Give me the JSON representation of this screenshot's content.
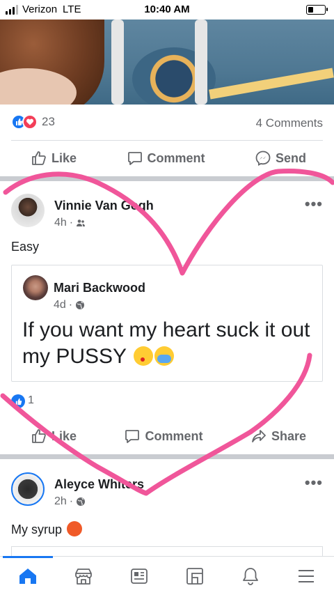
{
  "status_bar": {
    "carrier": "Verizon",
    "network": "LTE",
    "time": "10:40 AM"
  },
  "top_post": {
    "reaction_count": "23",
    "comments": "4 Comments"
  },
  "actions_top": {
    "like": "Like",
    "comment": "Comment",
    "send": "Send"
  },
  "post2": {
    "author": "Vinnie Van Gogh",
    "time": "4h",
    "text": "Easy",
    "shared": {
      "author": "Mari Backwood",
      "time": "4d",
      "text": "If you want my heart suck it out my PUSSY"
    },
    "reaction_count": "1",
    "actions": {
      "like": "Like",
      "comment": "Comment",
      "share": "Share"
    }
  },
  "post3": {
    "author": "Aleyce Whiters",
    "time": "2h",
    "text": "My syrup"
  },
  "colors": {
    "brand": "#1877f2",
    "overlay_heart": "#f0569a",
    "love": "#f33e58"
  },
  "nav": [
    "home-icon",
    "marketplace-icon",
    "news-icon",
    "pages-icon",
    "bell-icon",
    "menu-icon"
  ]
}
